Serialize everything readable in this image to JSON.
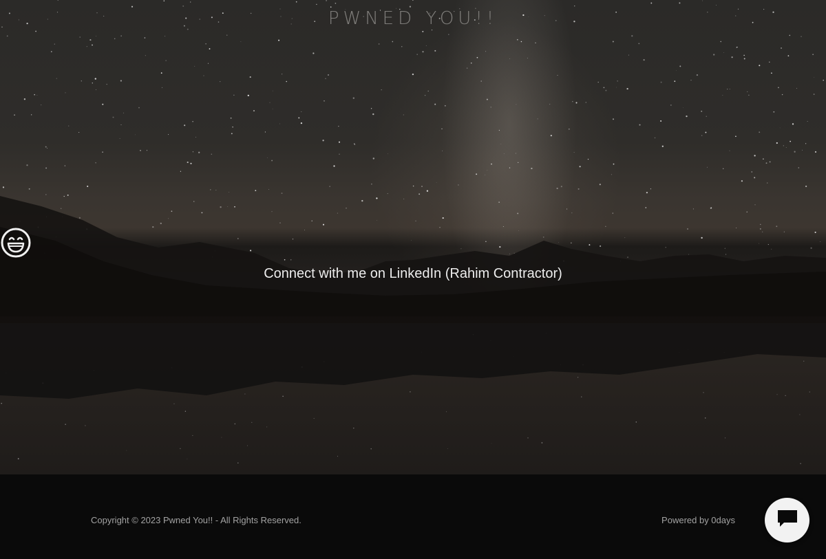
{
  "header": {
    "site_title": "PWNED YOU!!"
  },
  "main": {
    "icon": "smile-icon",
    "link_text": "Connect with me on LinkedIn (Rahim Contractor)"
  },
  "footer": {
    "copyright": "Copyright © 2023 Pwned You!! - All Rights Reserved.",
    "powered_by": "Powered by 0days"
  },
  "chat": {
    "icon": "chat-bubble-icon"
  },
  "colors": {
    "footer_bg": "#0a0a0a",
    "title": "#7f7d7a",
    "link": "#ededed",
    "chat_button": "#f2f2f2"
  }
}
